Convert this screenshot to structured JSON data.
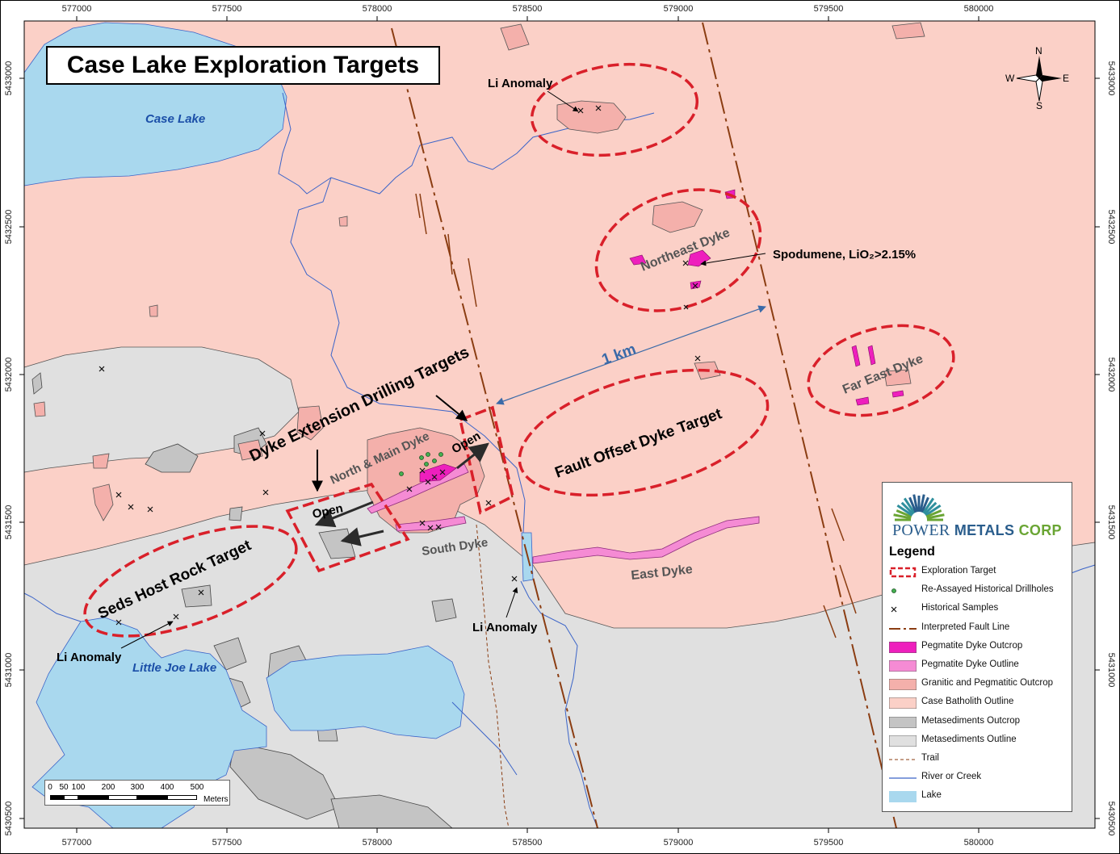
{
  "title": "Case Lake Exploration Targets",
  "axis": {
    "x_labels": [
      "577000",
      "577500",
      "578000",
      "578500",
      "579000",
      "579500",
      "580000"
    ],
    "y_labels": [
      "5433000",
      "5432500",
      "5432000",
      "5431500",
      "5431000",
      "5430500"
    ]
  },
  "compass": {
    "n": "N",
    "s": "S",
    "e": "E",
    "w": "W"
  },
  "map_labels": {
    "case_lake": "Case Lake",
    "little_joe_lake": "Little Joe Lake",
    "li_anomaly_top": "Li Anomaly",
    "li_anomaly_left": "Li Anomaly",
    "li_anomaly_bottom": "Li Anomaly",
    "northeast_dyke": "Northeast Dyke",
    "spodumene": "Spodumene, LiO₂>2.15%",
    "far_east_dyke": "Far East Dyke",
    "one_km": "1 km",
    "dyke_extension": "Dyke Extension Drilling Targets",
    "north_main_dyke": "North & Main Dyke",
    "south_dyke": "South Dyke",
    "east_dyke": "East Dyke",
    "open_east": "Open",
    "open_west": "Open",
    "fault_offset": "Fault Offset Dyke Target",
    "seds_host": "Seds Host Rock Target"
  },
  "logo": {
    "word1": "POWER",
    "word2": "METALS",
    "word3": "CORP"
  },
  "legend": {
    "title": "Legend",
    "items": [
      {
        "label": "Exploration Target",
        "type": "target"
      },
      {
        "label": "Re-Assayed Historical Drillholes",
        "type": "drill"
      },
      {
        "label": "Historical Samples",
        "type": "sample"
      },
      {
        "label": "Interpreted Fault Line",
        "type": "fault"
      },
      {
        "label": "Pegmatite Dyke Outcrop",
        "type": "peg_out"
      },
      {
        "label": "Pegmatite Dyke Outline",
        "type": "peg_line"
      },
      {
        "label": "Granitic and Pegmatitic Outcrop",
        "type": "granitic"
      },
      {
        "label": "Case Batholith Outline",
        "type": "batholith"
      },
      {
        "label": "Metasediments Outcrop",
        "type": "meta_out"
      },
      {
        "label": "Metasediments Outline",
        "type": "meta_line"
      },
      {
        "label": "Trail",
        "type": "trail"
      },
      {
        "label": "River or Creek",
        "type": "river"
      },
      {
        "label": "Lake",
        "type": "lake"
      }
    ]
  },
  "scale": {
    "ticks": [
      "0",
      "50",
      "100",
      "200",
      "300",
      "400",
      "500"
    ],
    "unit": "Meters"
  },
  "colors": {
    "batholith": "#fbd0c7",
    "metasediment": "#e0e0e0",
    "meta_outcrop": "#c4c4c4",
    "granitic": "#f4b0ab",
    "lake": "#a9d8ee",
    "river": "#3b64c8",
    "fault": "#8b3d12",
    "target": "#d9202a",
    "peg_outcrop": "#ee1fbd",
    "peg_outline": "#f58bd4"
  }
}
